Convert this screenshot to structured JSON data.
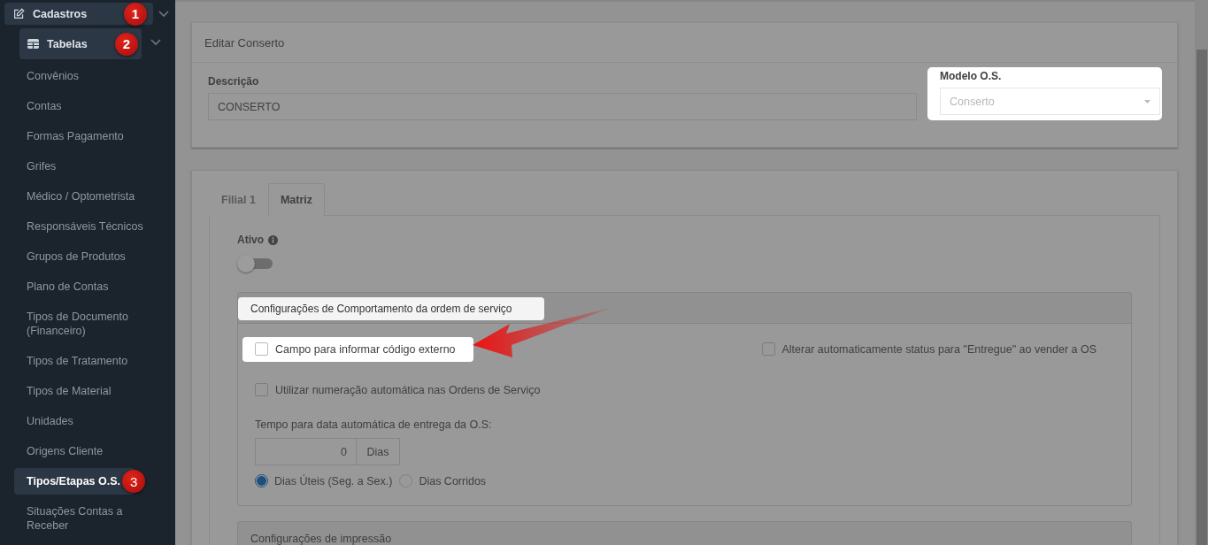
{
  "sidebar": {
    "items": [
      {
        "label": "Cadastros",
        "badge": "1",
        "expanded": true,
        "children": [
          {
            "label": "Tabelas",
            "badge": "2",
            "expanded": true,
            "children": [
              {
                "label": "Convênios",
                "selected": false
              },
              {
                "label": "Contas",
                "selected": false
              },
              {
                "label": "Formas Pagamento",
                "selected": false
              },
              {
                "label": "Grifes",
                "selected": false
              },
              {
                "label": "Médico / Optometrista",
                "selected": false
              },
              {
                "label": "Responsáveis Técnicos",
                "selected": false
              },
              {
                "label": "Grupos de Produtos",
                "selected": false
              },
              {
                "label": "Plano de Contas",
                "selected": false
              },
              {
                "label": "Tipos de Documento (Financeiro)",
                "selected": false
              },
              {
                "label": "Tipos de Tratamento",
                "selected": false
              },
              {
                "label": "Tipos de Material",
                "selected": false
              },
              {
                "label": "Unidades",
                "selected": false
              },
              {
                "label": "Origens Cliente",
                "selected": false
              },
              {
                "label": "Tipos/Etapas O.S.",
                "selected": true,
                "badge": "3"
              },
              {
                "label": "Situações Contas a Receber",
                "selected": false
              }
            ]
          }
        ]
      }
    ]
  },
  "edit_panel": {
    "title": "Editar Conserto",
    "description": {
      "label": "Descrição",
      "value": "CONSERTO"
    },
    "model": {
      "label": "Modelo O.S.",
      "value": "Conserto",
      "disabled": true,
      "highlighted": true
    }
  },
  "tabs": [
    {
      "label": "Filial 1",
      "selected": false
    },
    {
      "label": "Matriz",
      "selected": true
    }
  ],
  "active": {
    "label": "Ativo",
    "on": false
  },
  "behavior_section": {
    "title": "Configurações de Comportamento da ordem de serviço",
    "highlighted": true,
    "options": [
      {
        "label": "Campo para informar código externo",
        "checked": false,
        "highlighted": true
      },
      {
        "label": "Alterar automaticamente status para \"Entregue\" ao vender a OS",
        "checked": false,
        "highlighted": false
      },
      {
        "label": "Utilizar numeração automática nas Ordens de Serviço",
        "checked": false,
        "highlighted": false
      }
    ],
    "delivery": {
      "label": "Tempo para data automática de entrega da O.S:",
      "value": "0",
      "unit": "Dias"
    },
    "day_types": [
      {
        "label": "Dias Úteis (Seg. a Sex.)",
        "selected": true
      },
      {
        "label": "Dias Corridos",
        "selected": false
      }
    ]
  },
  "print_section": {
    "title": "Configurações de impressão"
  }
}
